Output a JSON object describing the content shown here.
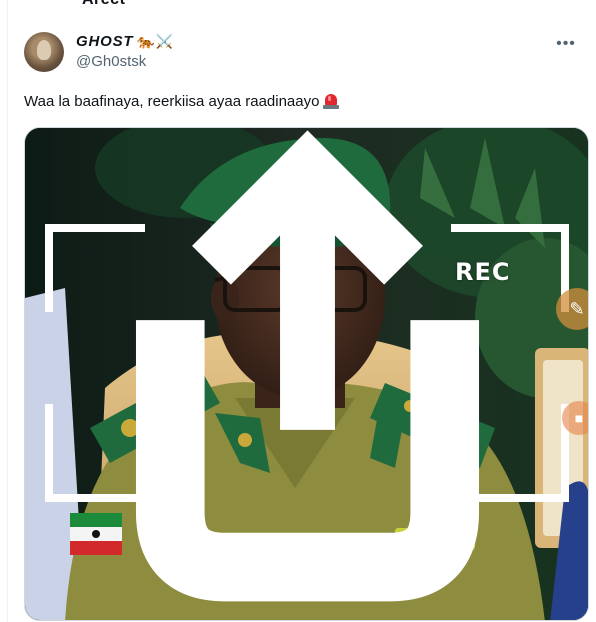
{
  "previous_tweet": {
    "snippet": "Arect"
  },
  "tweet": {
    "author": {
      "display_name": "GHOST",
      "name_emoji": "🐅⚔️",
      "handle": "@Gh0stsk"
    },
    "more_label": "•••",
    "text": "Waa la baafinaya, reerkiisa ayaa raadinaayo",
    "text_icon": "siren-icon",
    "media": {
      "overlay": {
        "rec_label": "REC",
        "upload_icon": "upload-icon",
        "edit_icon": "edit-icon",
        "flag_icon": "somaliland-flag-patch"
      }
    }
  },
  "colors": {
    "text_primary": "#0f1419",
    "text_secondary": "#536471",
    "uniform": "#8e8c3e",
    "beret": "#1f6b3d",
    "collar_green": "#1f6b3d"
  }
}
